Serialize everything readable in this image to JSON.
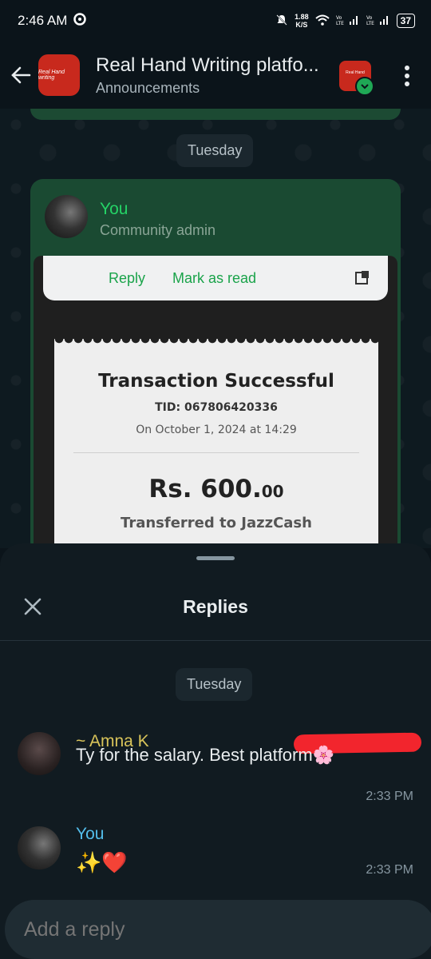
{
  "status_bar": {
    "time": "2:46 AM",
    "net_speed_value": "1.88",
    "net_speed_unit": "K/S",
    "battery": "37"
  },
  "header": {
    "title": "Real Hand Writing platfo...",
    "subtitle": "Announcements",
    "avatar_caption": "Real Hand writing",
    "community_caption": "Real Hand"
  },
  "chat": {
    "date_chip": "Tuesday",
    "message": {
      "sender": "You",
      "role": "Community admin",
      "screenshot": {
        "notification_reply": "Reply",
        "notification_mark_read": "Mark as read",
        "receipt": {
          "title": "Transaction Successful",
          "tid": "TID: 067806420336",
          "date": "On October 1, 2024 at 14:29",
          "amount_main": "Rs. 600.",
          "amount_decimal": "00",
          "transferred_to": "Transferred to JazzCash"
        }
      }
    }
  },
  "replies_sheet": {
    "title": "Replies",
    "date_chip": "Tuesday",
    "replies": [
      {
        "name": "~ Amna K",
        "text": "Ty for the salary. Best platform🌸",
        "time": "2:33 PM"
      },
      {
        "name": "You",
        "text": "✨❤️",
        "time": "2:33 PM"
      }
    ],
    "input_placeholder": "Add a reply"
  },
  "colors": {
    "background": "#0b141a",
    "bubble": "#1a4a32",
    "accent_green": "#25d366",
    "sheet": "#111b21"
  }
}
